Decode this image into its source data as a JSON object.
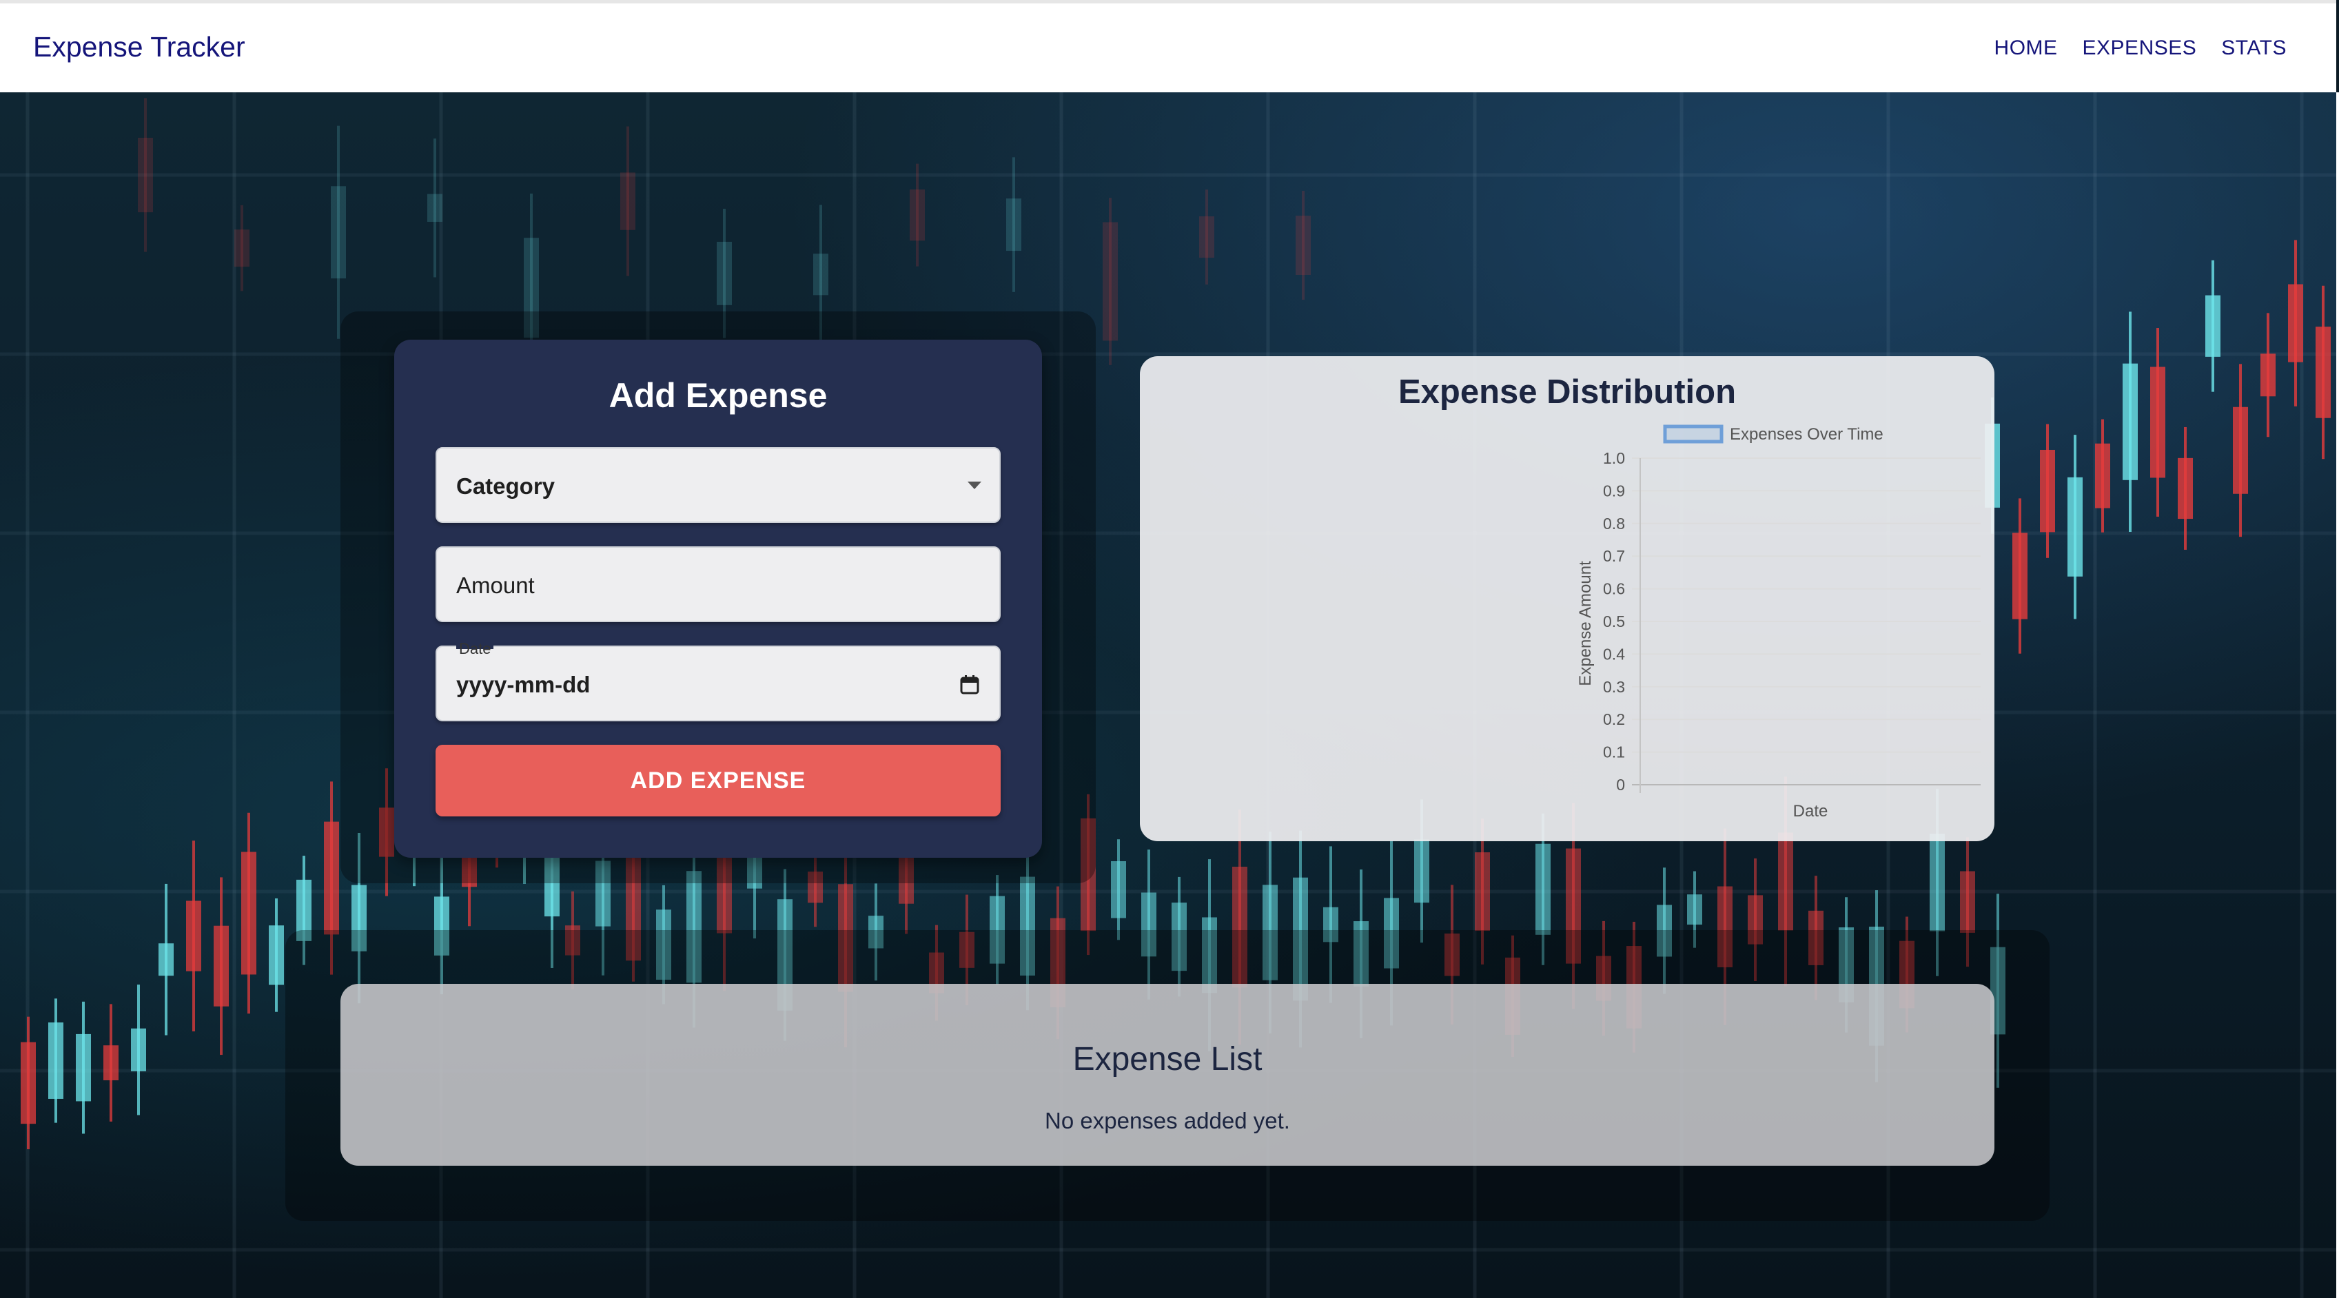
{
  "navbar": {
    "brand": "Expense Tracker",
    "links": [
      "HOME",
      "EXPENSES",
      "STATS"
    ]
  },
  "form": {
    "title": "Add Expense",
    "category_value": "Category",
    "amount_placeholder": "Amount",
    "date_label": "Date",
    "date_value": "yyyy-mm-dd",
    "submit_label": "ADD EXPENSE",
    "dropdown_icon": "chevron-down-icon",
    "calendar_icon": "calendar-icon"
  },
  "chart_card": {
    "title": "Expense Distribution"
  },
  "chart_data": {
    "type": "line",
    "legend": "Expenses Over Time",
    "legend_position": "top",
    "xlabel": "Date",
    "ylabel": "Expense Amount",
    "ylim": [
      0,
      1.0
    ],
    "yticks": [
      "1.0",
      "0.9",
      "0.8",
      "0.7",
      "0.6",
      "0.5",
      "0.4",
      "0.3",
      "0.2",
      "0.1",
      "0"
    ],
    "categories": [],
    "series": [
      {
        "name": "Expenses Over Time",
        "values": []
      }
    ],
    "grid": true,
    "line_color": "#6f9fd8"
  },
  "list": {
    "title": "Expense List",
    "empty_message": "No expenses added yet."
  },
  "colors": {
    "nav_text": "#15157a",
    "form_bg": "#252f50",
    "button_bg": "#e85f5a"
  }
}
